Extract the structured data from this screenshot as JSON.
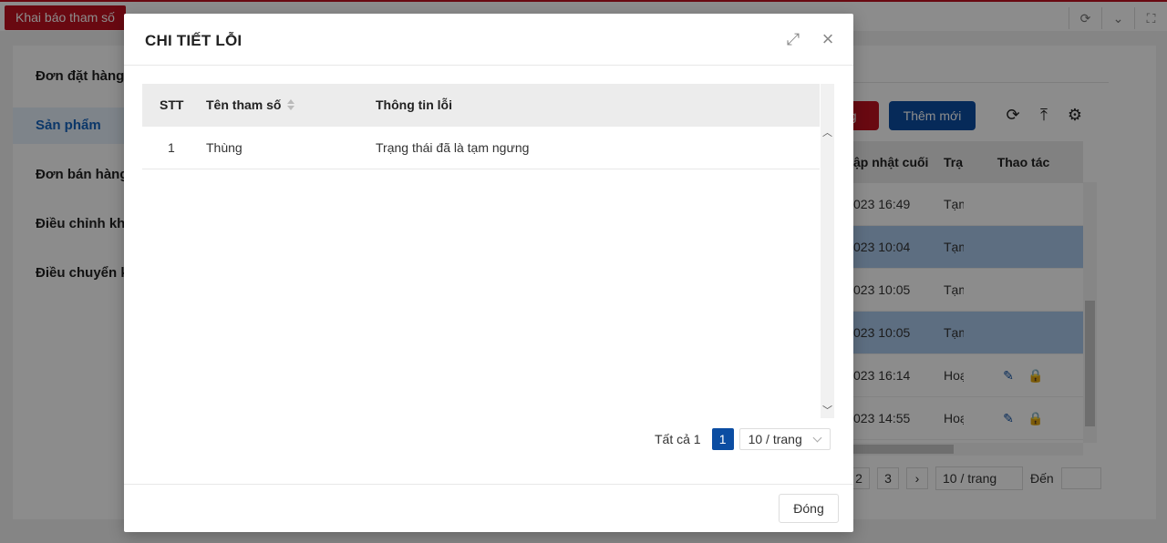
{
  "app": {
    "tab_label": "Khai báo tham số",
    "top_icons": [
      "refresh-icon",
      "chevron-down-icon",
      "fullscreen-icon"
    ]
  },
  "sidebar": {
    "items": [
      {
        "label": "Đơn đặt hàng",
        "active": false
      },
      {
        "label": "Sản phẩm",
        "active": true
      },
      {
        "label": "Đơn bán hàng",
        "active": false
      },
      {
        "label": "Điều chỉnh kho",
        "active": false
      },
      {
        "label": "Điều chuyển kho",
        "active": false
      }
    ]
  },
  "toolbar": {
    "red_button_label": "ng",
    "add_button_label": "Thêm mới",
    "icons": [
      "refresh-icon",
      "export-icon",
      "settings-icon"
    ]
  },
  "bg_table": {
    "headers": [
      "ập nhật cuối",
      "Trạ",
      "Thao tác"
    ],
    "rows": [
      {
        "updated": "023 16:49",
        "status": "Tạm",
        "selected": false,
        "actions": false
      },
      {
        "updated": "023 10:04",
        "status": "Tạm",
        "selected": true,
        "actions": false
      },
      {
        "updated": "023 10:05",
        "status": "Tạm",
        "selected": false,
        "actions": false
      },
      {
        "updated": "023 10:05",
        "status": "Tạm",
        "selected": true,
        "actions": false
      },
      {
        "updated": "023 16:14",
        "status": "Hoạ",
        "selected": false,
        "actions": true
      },
      {
        "updated": "023 14:55",
        "status": "Hoạ",
        "selected": false,
        "actions": true
      }
    ]
  },
  "bg_pager": {
    "page_prev": "2",
    "page_last": "3",
    "next": "›",
    "size_label": "10 / trang",
    "goto_label": "Đến"
  },
  "modal": {
    "title": "CHI TIẾT LỖI",
    "table": {
      "headers": {
        "stt": "STT",
        "name": "Tên tham số",
        "info": "Thông tin lỗi"
      },
      "rows": [
        {
          "stt": "1",
          "name": "Thùng",
          "info": "Trạng thái đã là tạm ngưng"
        }
      ]
    },
    "pager": {
      "total_label": "Tất cả 1",
      "current_page": "1",
      "size_label": "10 / trang"
    },
    "close_button_label": "Đóng"
  },
  "colors": {
    "brand_red": "#c0111f",
    "brand_blue": "#0b4da2",
    "selected_row": "#a9c8ec"
  }
}
